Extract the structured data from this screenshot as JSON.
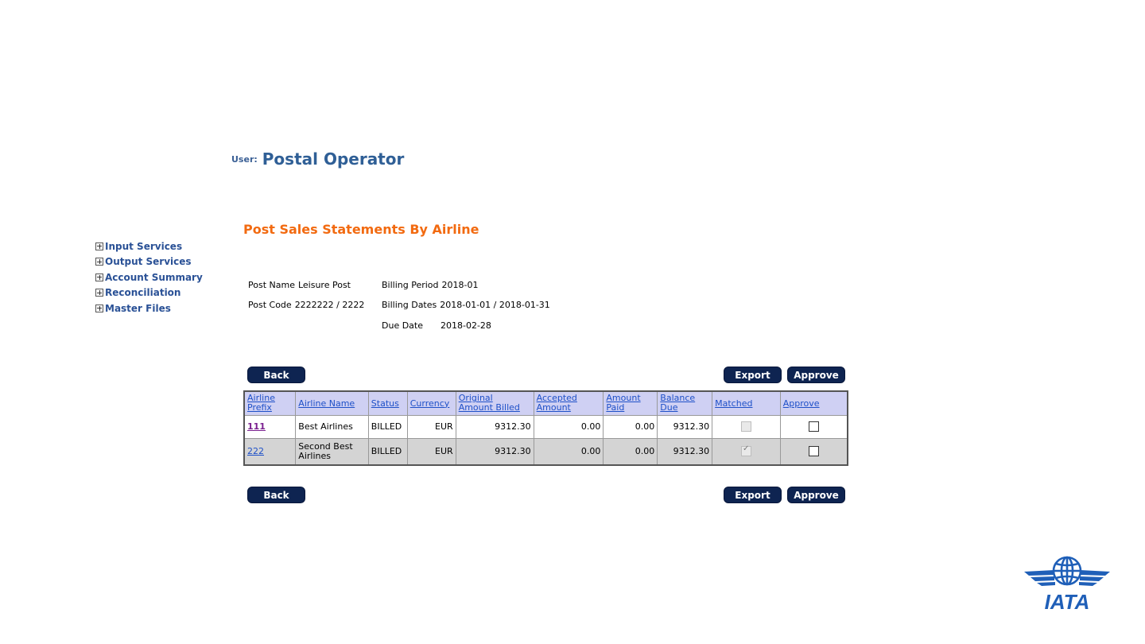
{
  "header": {
    "user_label": "User:",
    "user_name": "Postal Operator"
  },
  "nav": [
    {
      "label": "Input Services"
    },
    {
      "label": "Output Services"
    },
    {
      "label": "Account Summary"
    },
    {
      "label": "Reconciliation"
    },
    {
      "label": "Master Files"
    }
  ],
  "page_title": "Post Sales Statements By Airline",
  "info": {
    "post_name_label": "Post Name",
    "post_name_value": "Leisure Post",
    "post_code_label": "Post Code",
    "post_code_value": "2222222 / 2222",
    "billing_period_label": "Billing Period",
    "billing_period_value": "2018-01",
    "billing_dates_label": "Billing Dates",
    "billing_dates_value": "2018-01-01 / 2018-01-31",
    "due_date_label": "Due Date",
    "due_date_value": "2018-02-28"
  },
  "buttons": {
    "back": "Back",
    "export": "Export",
    "approve": "Approve"
  },
  "table": {
    "headers": {
      "airline_prefix": "Airline Prefix",
      "airline_name": "Airline Name",
      "status": "Status",
      "currency": "Currency",
      "original_amount_billed": "Original Amount Billed",
      "accepted_amount": "Accepted Amount",
      "amount_paid": "Amount Paid",
      "balance_due": "Balance Due",
      "matched": "Matched",
      "approve": "Approve"
    },
    "rows": [
      {
        "prefix": "111",
        "name": "Best Airlines",
        "status": "BILLED",
        "currency": "EUR",
        "original": "9312.30",
        "accepted": "0.00",
        "paid": "0.00",
        "balance": "9312.30",
        "matched": false,
        "approve": false
      },
      {
        "prefix": "222",
        "name": "Second Best Airlines",
        "status": "BILLED",
        "currency": "EUR",
        "original": "9312.30",
        "accepted": "0.00",
        "paid": "0.00",
        "balance": "9312.30",
        "matched": true,
        "approve": false
      }
    ]
  },
  "logo": {
    "text": "IATA",
    "icon": "globe-wings-icon",
    "color": "#1f5fb8"
  },
  "colors": {
    "title_orange": "#f26a10",
    "button_navy": "#0e2451",
    "header_lavender": "#cfd0f3",
    "link_blue": "#1e50c8"
  }
}
